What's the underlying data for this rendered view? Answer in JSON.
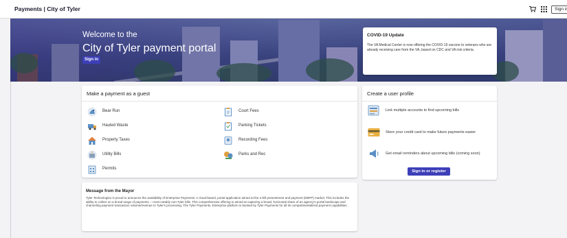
{
  "app": {
    "title": "Payments | City of Tyler"
  },
  "topbar": {
    "cart_icon": "cart-icon",
    "apps_icon": "grid-icon",
    "signin_label": "Sign in"
  },
  "hero": {
    "welcome_line1": "Welcome to the",
    "welcome_line2": "City of Tyler payment portal",
    "signin_label": "Sign in"
  },
  "covid": {
    "title": "COVID-19 Update",
    "body": "The VA Medical Center is now offering the COVID-19 vaccine to veterans who are already receiving care from the VA, based on CDC and VA risk criteria."
  },
  "guest": {
    "title": "Make a payment as a guest",
    "items": [
      {
        "label": "Bear Run",
        "icon": "bear-icon"
      },
      {
        "label": "Hauled Waste",
        "icon": "waste-truck-icon"
      },
      {
        "label": "Property Taxes",
        "icon": "house-icon"
      },
      {
        "label": "Utility Bills",
        "icon": "utility-icon"
      },
      {
        "label": "Permits",
        "icon": "permit-icon"
      },
      {
        "label": "Court Fees",
        "icon": "court-clipboard-icon"
      },
      {
        "label": "Parking Tickets",
        "icon": "ticket-clipboard-icon"
      },
      {
        "label": "Recording Fees",
        "icon": "recording-icon"
      },
      {
        "label": "Parks and Rec",
        "icon": "parks-icon"
      }
    ]
  },
  "mayor": {
    "title": "Message from the Mayor",
    "body": "Tyler Technologies is proud to announce the availability of Enterprise Payments: A cloud-based, portal application aimed at the e-bill presentment and payment (EBPP) market. This includes the ability to collect on a broad range of payments -- most notably non-Tyler bills. This comprehensive offering is aimed at capturing a broad, horizontal share of an agency's portal landscape and channeling payment transaction volume/revenue to Tyler's processing. The Tyler Payments, Enterprise platform is backed by Tyler Payments for all its compartmentalized payment capabilities."
  },
  "profile": {
    "title": "Create a user profile",
    "items": [
      {
        "label": "Link multiple accounts to find upcoming bills",
        "icon": "accounts-icon"
      },
      {
        "label": "Store your credit card to make future payments easier",
        "icon": "credit-card-icon"
      },
      {
        "label": "Get email reminders about upcoming bills (coming soon)",
        "icon": "megaphone-icon"
      }
    ],
    "register_label": "Sign in or register"
  },
  "colors": {
    "accent": "#3d3fb8",
    "hero_tint": "#343082"
  }
}
